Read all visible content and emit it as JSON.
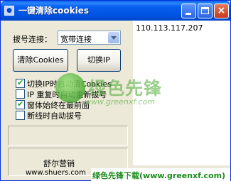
{
  "window": {
    "title": "一键清除cookies",
    "controls": {
      "minimize": "minimize",
      "maximize": "maximize",
      "close": "×"
    }
  },
  "dial": {
    "label": "拔号连接：",
    "selected": "宽带连接"
  },
  "buttons": {
    "clear_cookies": "清除Cookies",
    "switch_ip": "切换IP"
  },
  "options": [
    {
      "label": "切换IP时自动清Cookies",
      "checked": true
    },
    {
      "label": "IP 重复时自动重新拔号",
      "checked": false
    },
    {
      "label": "窗体始终在最前面",
      "checked": true
    },
    {
      "label": "断线时自动拔号",
      "checked": false
    }
  ],
  "ip_list": [
    "110.113.117.207"
  ],
  "footer": {
    "brand": "舒尔营销",
    "site": "www.shuers.com"
  },
  "watermark": {
    "text": "绿色先锋",
    "url": "www.greenxf.com",
    "banner": "绿色先锋下载(www.greenxf.com)"
  },
  "colors": {
    "titlebar": "#0054E3",
    "window_bg": "#ECE9D8",
    "watermark": "#4AA832"
  }
}
